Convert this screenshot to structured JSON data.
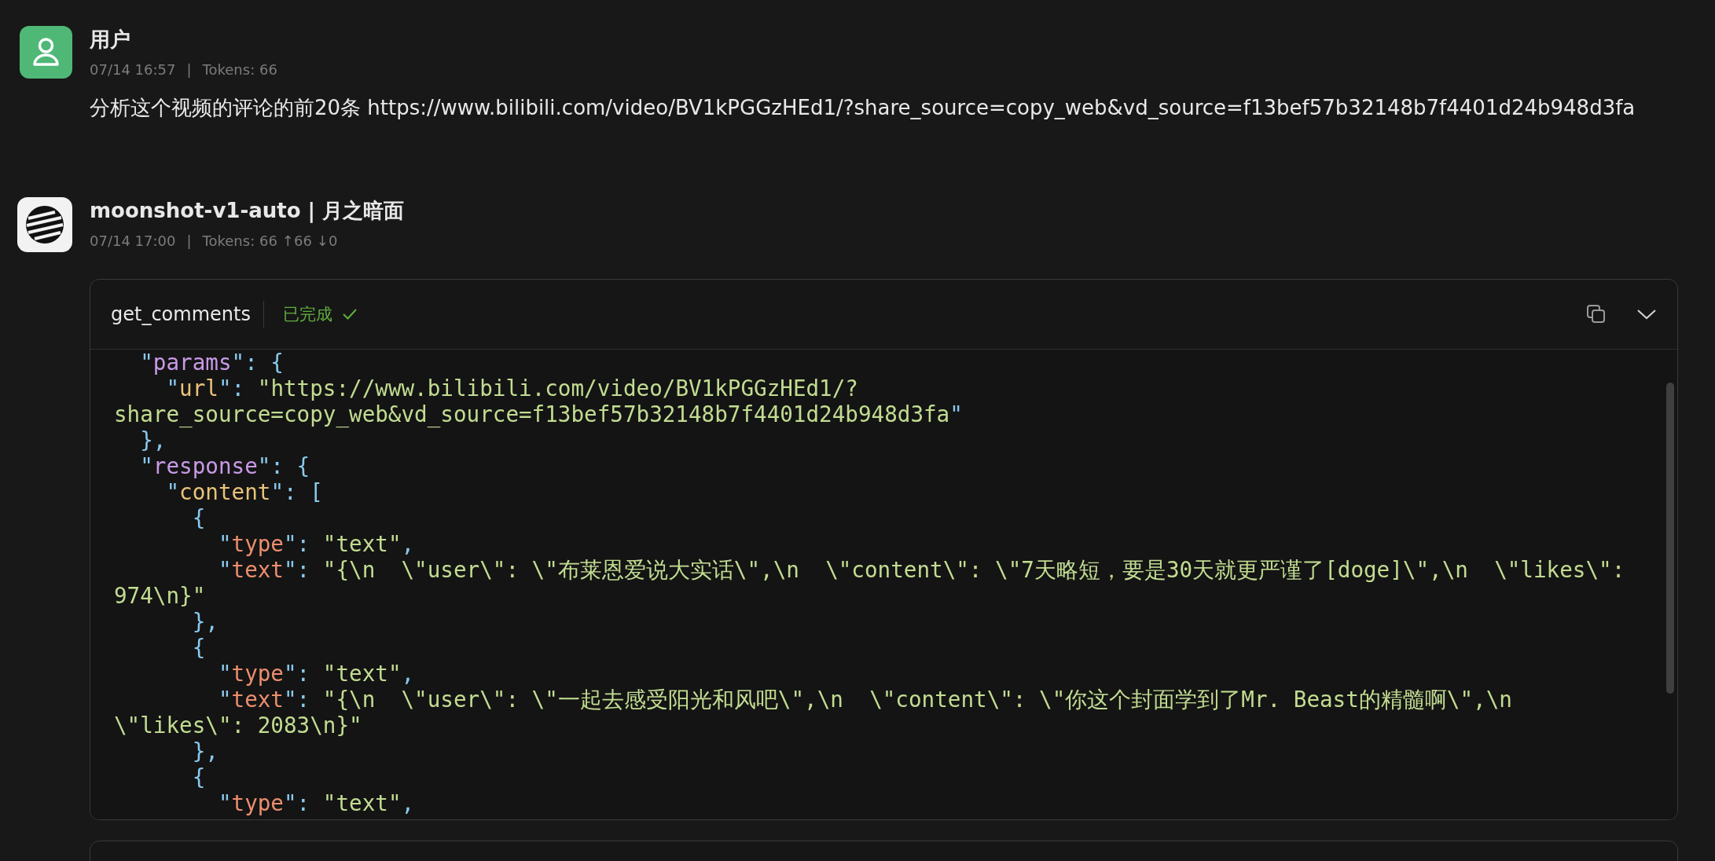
{
  "messages": [
    {
      "kind": "user",
      "name": "用户",
      "time": "07/14 16:57",
      "separator": "|",
      "tokens": "Tokens: 66",
      "text": "分析这个视频的评论的前20条 https://www.bilibili.com/video/BV1kPGGzHEd1/?share_source=copy_web&vd_source=f13bef57b32148b7f4401d24b948d3fa"
    },
    {
      "kind": "assistant",
      "name": "moonshot-v1-auto | 月之暗面",
      "time": "07/14 17:00",
      "separator": "|",
      "tokens": "Tokens: 66",
      "up": "↑66",
      "down": "↓0",
      "tool": {
        "name": "get_comments",
        "status": "已完成",
        "done": true,
        "code_lines": [
          [
            {
              "kind": "p",
              "t": "  \""
            },
            {
              "kind": "k1",
              "t": "params"
            },
            {
              "kind": "p",
              "t": "\": {"
            }
          ],
          [
            {
              "kind": "p",
              "t": "    \""
            },
            {
              "kind": "k2",
              "t": "url"
            },
            {
              "kind": "p",
              "t": "\": "
            },
            {
              "kind": "s",
              "t": "\"https://www.bilibili.com/video/BV1kPGGzHEd1/?"
            }
          ],
          [
            {
              "kind": "s",
              "t": "share_source=copy_web&vd_source=f13bef57b32148b7f4401d24b948d3fa"
            },
            {
              "kind": "p",
              "t": "\""
            }
          ],
          [
            {
              "kind": "p",
              "t": "  },"
            }
          ],
          [
            {
              "kind": "p",
              "t": "  \""
            },
            {
              "kind": "k1",
              "t": "response"
            },
            {
              "kind": "p",
              "t": "\": {"
            }
          ],
          [
            {
              "kind": "p",
              "t": "    \""
            },
            {
              "kind": "k2",
              "t": "content"
            },
            {
              "kind": "p",
              "t": "\": ["
            }
          ],
          [
            {
              "kind": "p",
              "t": "      {"
            }
          ],
          [
            {
              "kind": "p",
              "t": "        \""
            },
            {
              "kind": "k3",
              "t": "type"
            },
            {
              "kind": "p",
              "t": "\": "
            },
            {
              "kind": "s",
              "t": "\"text\""
            },
            {
              "kind": "p",
              "t": ","
            }
          ],
          [
            {
              "kind": "p",
              "t": "        \""
            },
            {
              "kind": "k3",
              "t": "text"
            },
            {
              "kind": "p",
              "t": "\": "
            },
            {
              "kind": "s",
              "t": "\"{\\n  \\\"user\\\": \\\"布莱恩爱说大实话\\\",\\n  \\\"content\\\": \\\"7天略短，要是30天就更严谨了[doge]\\\",\\n  \\\"likes\\\":"
            }
          ],
          [
            {
              "kind": "s",
              "t": "974\\n}\""
            }
          ],
          [
            {
              "kind": "p",
              "t": "      },"
            }
          ],
          [
            {
              "kind": "p",
              "t": "      {"
            }
          ],
          [
            {
              "kind": "p",
              "t": "        \""
            },
            {
              "kind": "k3",
              "t": "type"
            },
            {
              "kind": "p",
              "t": "\": "
            },
            {
              "kind": "s",
              "t": "\"text\""
            },
            {
              "kind": "p",
              "t": ","
            }
          ],
          [
            {
              "kind": "p",
              "t": "        \""
            },
            {
              "kind": "k3",
              "t": "text"
            },
            {
              "kind": "p",
              "t": "\": "
            },
            {
              "kind": "s",
              "t": "\"{\\n  \\\"user\\\": \\\"一起去感受阳光和风吧\\\",\\n  \\\"content\\\": \\\"你这个封面学到了Mr. Beast的精髓啊\\\",\\n"
            }
          ],
          [
            {
              "kind": "s",
              "t": "\\\"likes\\\": 2083\\n}\""
            }
          ],
          [
            {
              "kind": "p",
              "t": "      },"
            }
          ],
          [
            {
              "kind": "p",
              "t": "      {"
            }
          ],
          [
            {
              "kind": "p",
              "t": "        \""
            },
            {
              "kind": "k3",
              "t": "type"
            },
            {
              "kind": "p",
              "t": "\": "
            },
            {
              "kind": "s",
              "t": "\"text\""
            },
            {
              "kind": "p",
              "t": ","
            }
          ]
        ]
      }
    }
  ],
  "next_card": {
    "kind": "tool"
  }
}
